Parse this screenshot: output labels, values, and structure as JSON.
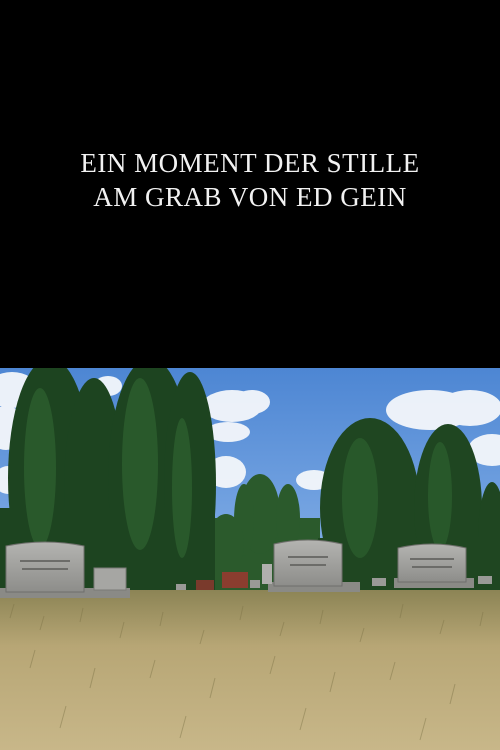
{
  "poster": {
    "title_line_1": "EIN MOMENT DER STILLE",
    "title_line_2": "AM GRAB VON ED GEIN"
  },
  "colors": {
    "background": "#000000",
    "title_text": "#f2f2f2",
    "sky": "#5b8fd6",
    "grass": "#b8a77a",
    "tree": "#1f4a24",
    "headstone": "#9a9a98"
  }
}
